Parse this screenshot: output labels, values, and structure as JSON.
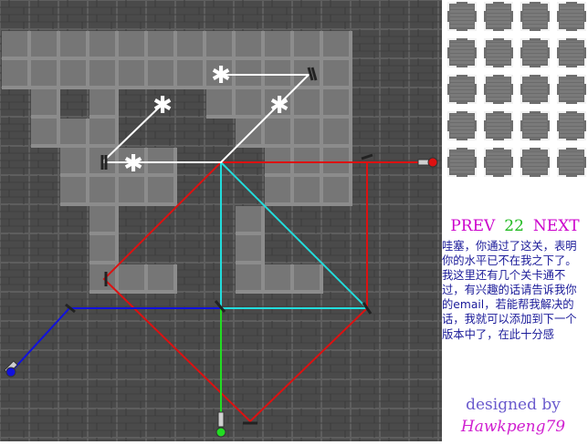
{
  "nav": {
    "prev_label": "PREV",
    "level": "22",
    "next_label": "NEXT"
  },
  "message": "哇塞，你通过了这关，表明你的水平已不在我之下了。我这里还有几个关卡通不过，有兴趣的话请告诉我你的email，若能帮我解决的话，我就可以添加到下一个版本中了，在此十分感",
  "credit": {
    "line1": "designed by",
    "line2": "Hawkpeng79"
  },
  "palette": {
    "slots": 20
  },
  "colors": {
    "board_dark": "#4a4a4a",
    "board_light": "#767676",
    "beam_red": "#dd1111",
    "beam_cyan": "#22dddd",
    "beam_blue": "#1111dd",
    "beam_green": "#22dd22",
    "beam_white": "#ffffff",
    "accent_magenta": "#cc00cc",
    "accent_green": "#22bb22",
    "text_blue": "#1a1a99"
  },
  "icons": [
    "laser-emitter-icon",
    "mirror-icon",
    "sparkle-target-icon",
    "wall-block-icon"
  ]
}
